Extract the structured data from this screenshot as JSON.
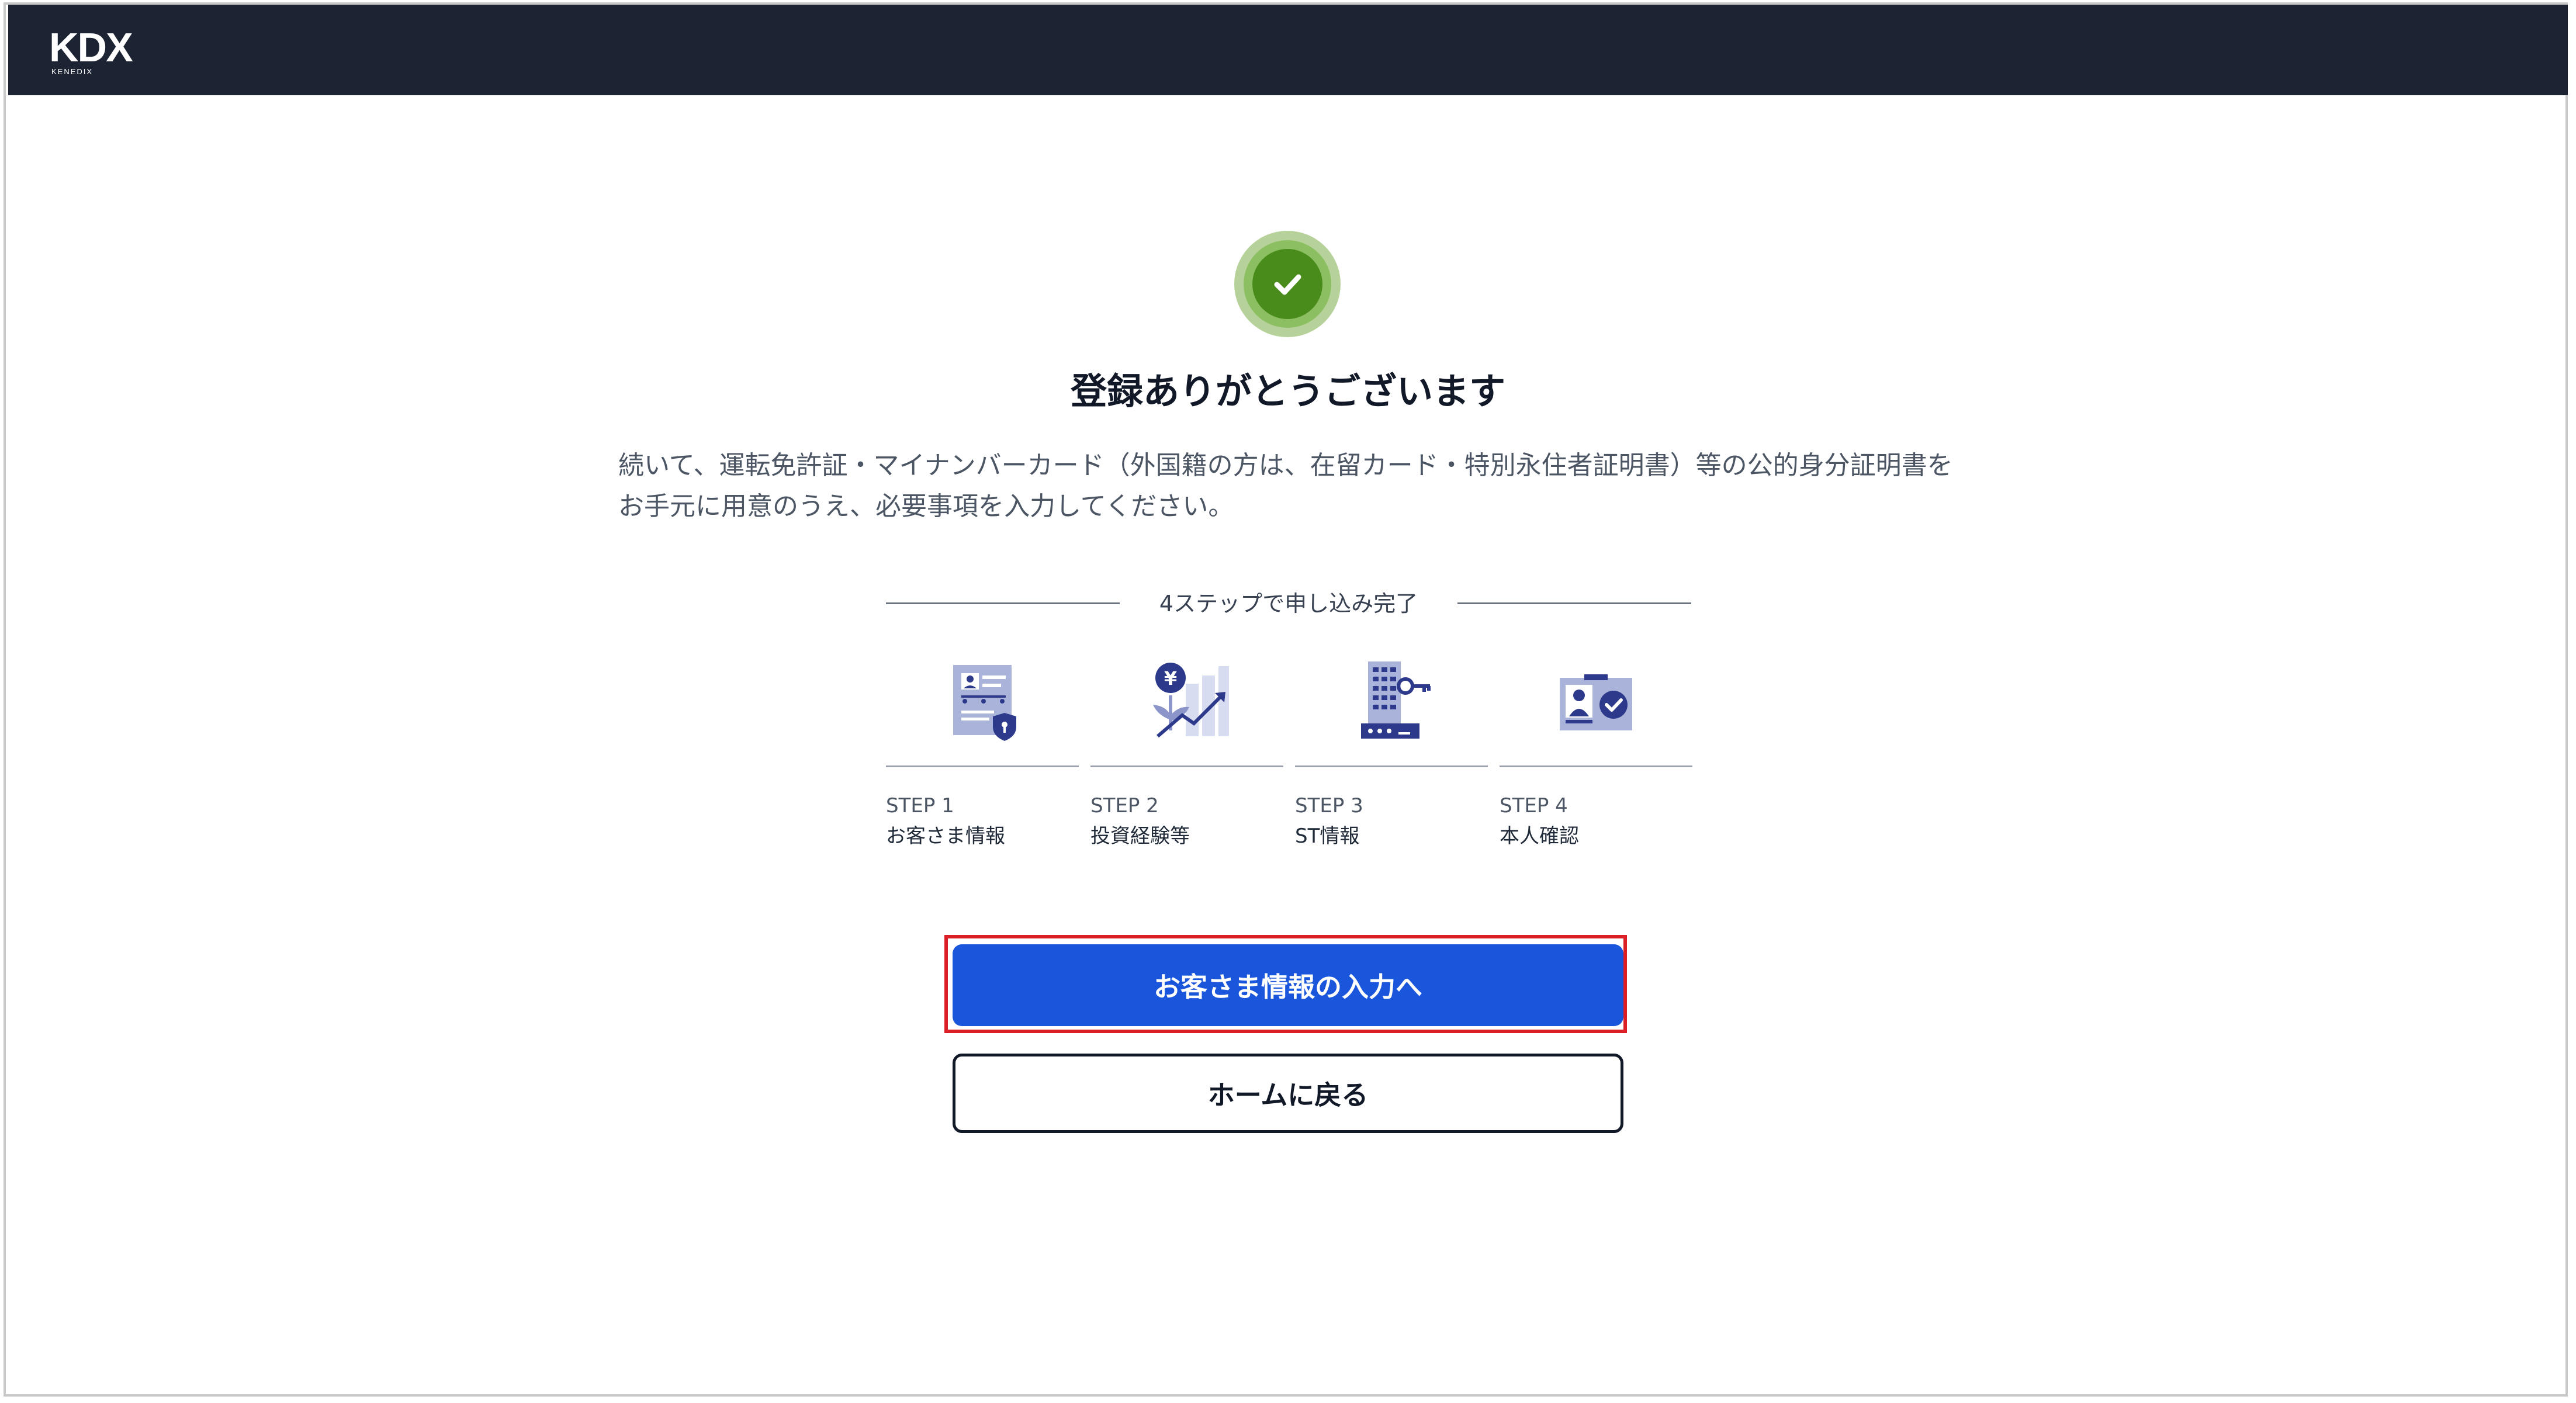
{
  "header": {
    "logo_main": "KDX",
    "logo_sub": "KENEDIX"
  },
  "completion": {
    "icon": "check-icon",
    "title": "登録ありがとうございます",
    "description": "続いて、運転免許証・マイナンバーカード（外国籍の方は、在留カード・特別永住者証明書）等の公的身分証明書をお手元に用意のうえ、必要事項を入力してください。"
  },
  "steps": {
    "heading": "4ステップで申し込み完了",
    "items": [
      {
        "number": "STEP 1",
        "label": "お客さま情報",
        "icon": "profile-document-shield-icon"
      },
      {
        "number": "STEP 2",
        "label": "投資経験等",
        "icon": "yen-growth-chart-icon"
      },
      {
        "number": "STEP 3",
        "label": "ST情報",
        "icon": "building-key-icon"
      },
      {
        "number": "STEP 4",
        "label": "本人確認",
        "icon": "id-card-verified-icon"
      }
    ]
  },
  "actions": {
    "primary_label": "お客さま情報の入力へ",
    "secondary_label": "ホームに戻る"
  },
  "colors": {
    "header_bg": "#1c2434",
    "primary": "#1a56db",
    "success": "#4a8c1c",
    "highlight": "#dc1f26",
    "icon_blue": "#2d3a8c"
  }
}
